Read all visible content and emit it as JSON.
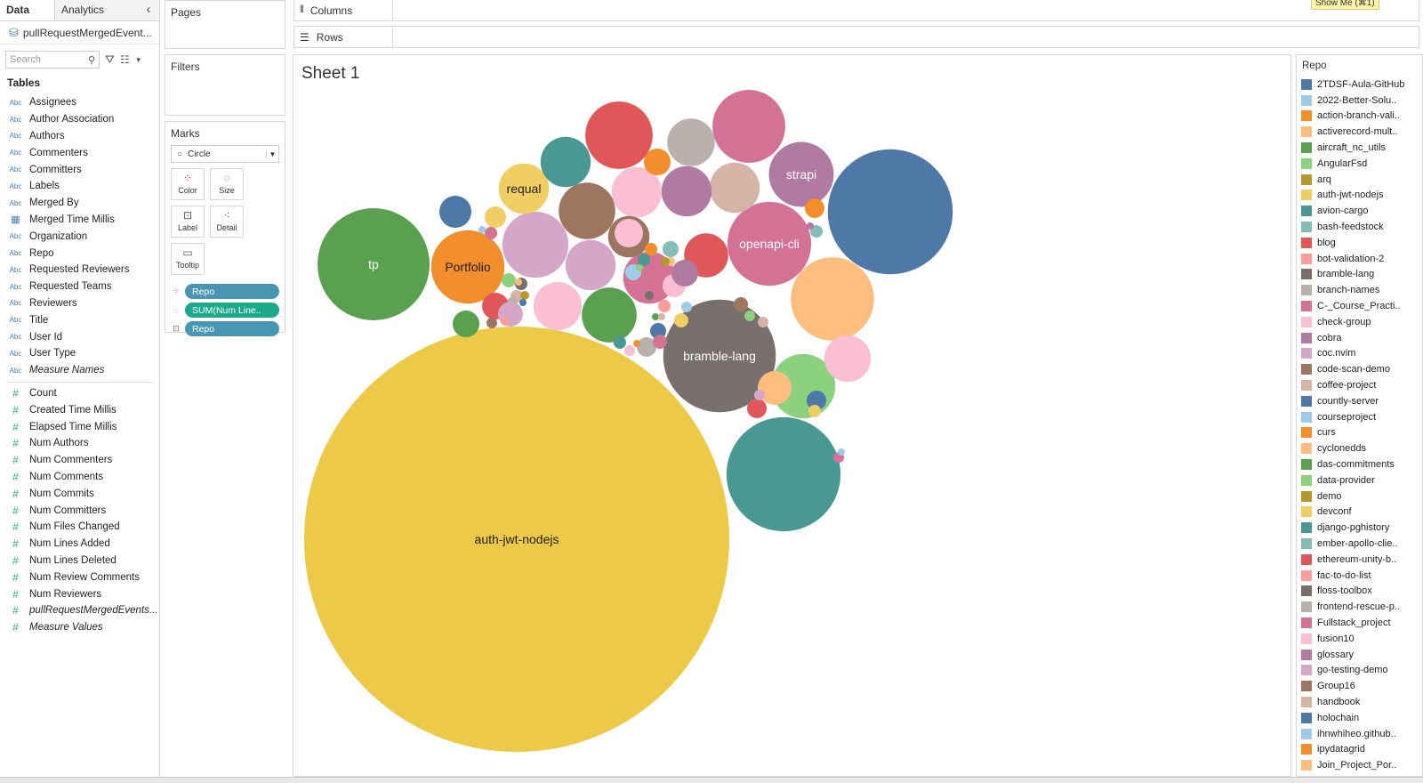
{
  "left_panel": {
    "tabs": [
      "Data",
      "Analytics"
    ],
    "datasource": "pullRequestMergedEvent...",
    "search_placeholder": "Search",
    "tables_header": "Tables",
    "dimensions": [
      {
        "type": "Abc",
        "name": "Assignees"
      },
      {
        "type": "Abc",
        "name": "Author Association"
      },
      {
        "type": "Abc",
        "name": "Authors"
      },
      {
        "type": "Abc",
        "name": "Commenters"
      },
      {
        "type": "Abc",
        "name": "Committers"
      },
      {
        "type": "Abc",
        "name": "Labels"
      },
      {
        "type": "Abc",
        "name": "Merged By"
      },
      {
        "type": "date",
        "name": "Merged Time Millis"
      },
      {
        "type": "Abc",
        "name": "Organization"
      },
      {
        "type": "Abc",
        "name": "Repo"
      },
      {
        "type": "Abc",
        "name": "Requested Reviewers"
      },
      {
        "type": "Abc",
        "name": "Requested Teams"
      },
      {
        "type": "Abc",
        "name": "Reviewers"
      },
      {
        "type": "Abc",
        "name": "Title"
      },
      {
        "type": "Abc",
        "name": "User Id"
      },
      {
        "type": "Abc",
        "name": "User Type"
      },
      {
        "type": "Abc",
        "name": "Measure Names",
        "italic": true
      }
    ],
    "measures": [
      {
        "name": "Count"
      },
      {
        "name": "Created Time Millis"
      },
      {
        "name": "Elapsed Time Millis"
      },
      {
        "name": "Num Authors"
      },
      {
        "name": "Num Commenters"
      },
      {
        "name": "Num Comments"
      },
      {
        "name": "Num Commits"
      },
      {
        "name": "Num Committers"
      },
      {
        "name": "Num Files Changed"
      },
      {
        "name": "Num Lines Added"
      },
      {
        "name": "Num Lines Deleted"
      },
      {
        "name": "Num Review Comments"
      },
      {
        "name": "Num Reviewers"
      },
      {
        "name": "pullRequestMergedEvents...",
        "italic": true
      },
      {
        "name": "Measure Values",
        "italic": true
      }
    ]
  },
  "cards": {
    "pages": "Pages",
    "filters": "Filters",
    "marks": "Marks",
    "mark_type": "Circle",
    "mark_buttons": [
      "Color",
      "Size",
      "Label",
      "Detail",
      "Tooltip"
    ],
    "pills": [
      {
        "label": "Repo",
        "color": "#4996b2"
      },
      {
        "label": "SUM(Num Line..",
        "color": "#1ba98a"
      },
      {
        "label": "Repo",
        "color": "#4996b2"
      }
    ]
  },
  "shelves": {
    "columns": "Columns",
    "rows": "Rows"
  },
  "tooltip": "Show Me (⌘1)",
  "sheet_title": "Sheet 1",
  "chart_data": {
    "type": "packed-bubble",
    "size_measure": "SUM(Num Lines Added)",
    "labels_visible": [
      "auth-jwt-nodejs",
      "tp",
      "Portfolio",
      "requal",
      "strapi",
      "openapi-cli",
      "bramble-lang"
    ],
    "bubbles": [
      {
        "label": "auth-jwt-nodejs",
        "color": "#edc948",
        "size": 55900
      },
      {
        "label": "",
        "color": "#4e79a7",
        "size": 4830
      },
      {
        "label": "bramble-lang",
        "color": "#79706e",
        "size": 3920
      },
      {
        "label": "",
        "color": "#499894",
        "size": 4020
      },
      {
        "label": "tp",
        "color": "#59a14f",
        "size": 3880
      },
      {
        "label": "",
        "color": "#ffbe7d",
        "size": 2140
      },
      {
        "label": "openapi-cli",
        "color": "#d37295",
        "size": 2170
      },
      {
        "label": "Portfolio",
        "color": "#f28e2b",
        "size": 1660
      },
      {
        "label": "",
        "color": "#e15759",
        "size": 1400
      },
      {
        "label": "",
        "color": "#d37295",
        "size": 1640
      },
      {
        "label": "",
        "color": "#d4a6c8",
        "size": 1350
      },
      {
        "label": "strapi",
        "color": "#b07aa1",
        "size": 1300
      },
      {
        "label": "",
        "color": "#8cd17d",
        "size": 1280
      },
      {
        "label": "",
        "color": "#9d7660",
        "size": 990
      },
      {
        "label": "",
        "color": "#d37295",
        "size": 840
      },
      {
        "label": "",
        "color": "#d7b5a6",
        "size": 780
      },
      {
        "label": "",
        "color": "#bab0ac",
        "size": 700
      },
      {
        "label": "requal",
        "color": "#f1ce63",
        "size": 780
      },
      {
        "label": "",
        "color": "#b07aa1",
        "size": 780
      },
      {
        "label": "",
        "color": "#fabfd2",
        "size": 780
      },
      {
        "label": "",
        "color": "#d4a6c8",
        "size": 780
      },
      {
        "label": "",
        "color": "#59a14f",
        "size": 930
      },
      {
        "label": "",
        "color": "#fabfd2",
        "size": 720
      },
      {
        "label": "",
        "color": "#fabfd2",
        "size": 670
      },
      {
        "label": "",
        "color": "#499894",
        "size": 780
      },
      {
        "label": "",
        "color": "#9d7660",
        "size": 530
      },
      {
        "label": "",
        "color": "#e15759",
        "size": 600
      }
    ]
  },
  "legend": {
    "title": "Repo",
    "items": [
      {
        "name": "2TDSF-Aula-GitHub",
        "color": "#4e79a7"
      },
      {
        "name": "2022-Better-Solu..",
        "color": "#a0cbe8"
      },
      {
        "name": "action-branch-vali..",
        "color": "#f28e2b"
      },
      {
        "name": "activerecord-mult..",
        "color": "#ffbe7d"
      },
      {
        "name": "aircraft_nc_utils",
        "color": "#59a14f"
      },
      {
        "name": "AngularFsd",
        "color": "#8cd17d"
      },
      {
        "name": "arq",
        "color": "#b6992d"
      },
      {
        "name": "auth-jwt-nodejs",
        "color": "#f1ce63"
      },
      {
        "name": "avion-cargo",
        "color": "#499894"
      },
      {
        "name": "bash-feedstock",
        "color": "#86bcb6"
      },
      {
        "name": "blog",
        "color": "#e15759"
      },
      {
        "name": "bot-validation-2",
        "color": "#ff9d9a"
      },
      {
        "name": "bramble-lang",
        "color": "#79706e"
      },
      {
        "name": "branch-names",
        "color": "#bab0ac"
      },
      {
        "name": "C-_Course_Practi..",
        "color": "#d37295"
      },
      {
        "name": "check-group",
        "color": "#fabfd2"
      },
      {
        "name": "cobra",
        "color": "#b07aa1"
      },
      {
        "name": "coc.nvim",
        "color": "#d4a6c8"
      },
      {
        "name": "code-scan-demo",
        "color": "#9d7660"
      },
      {
        "name": "coffee-project",
        "color": "#d7b5a6"
      },
      {
        "name": "countly-server",
        "color": "#4e79a7"
      },
      {
        "name": "courseproject",
        "color": "#a0cbe8"
      },
      {
        "name": "curs",
        "color": "#f28e2b"
      },
      {
        "name": "cyclonedds",
        "color": "#ffbe7d"
      },
      {
        "name": "das-commitments",
        "color": "#59a14f"
      },
      {
        "name": "data-provider",
        "color": "#8cd17d"
      },
      {
        "name": "demo",
        "color": "#b6992d"
      },
      {
        "name": "devconf",
        "color": "#f1ce63"
      },
      {
        "name": "django-pghistory",
        "color": "#499894"
      },
      {
        "name": "ember-apollo-clie..",
        "color": "#86bcb6"
      },
      {
        "name": "ethereum-unity-b..",
        "color": "#e15759"
      },
      {
        "name": "fac-to-do-list",
        "color": "#ff9d9a"
      },
      {
        "name": "floss-toolbox",
        "color": "#79706e"
      },
      {
        "name": "frontend-rescue-p..",
        "color": "#bab0ac"
      },
      {
        "name": "Fullstack_project",
        "color": "#d37295"
      },
      {
        "name": "fusion10",
        "color": "#fabfd2"
      },
      {
        "name": "glossary",
        "color": "#b07aa1"
      },
      {
        "name": "go-testing-demo",
        "color": "#d4a6c8"
      },
      {
        "name": "Group16",
        "color": "#9d7660"
      },
      {
        "name": "handbook",
        "color": "#d7b5a6"
      },
      {
        "name": "holochain",
        "color": "#4e79a7"
      },
      {
        "name": "ihnwhiheo.github..",
        "color": "#a0cbe8"
      },
      {
        "name": "ipydatagrid",
        "color": "#f28e2b"
      },
      {
        "name": "Join_Project_Por..",
        "color": "#ffbe7d"
      }
    ]
  }
}
